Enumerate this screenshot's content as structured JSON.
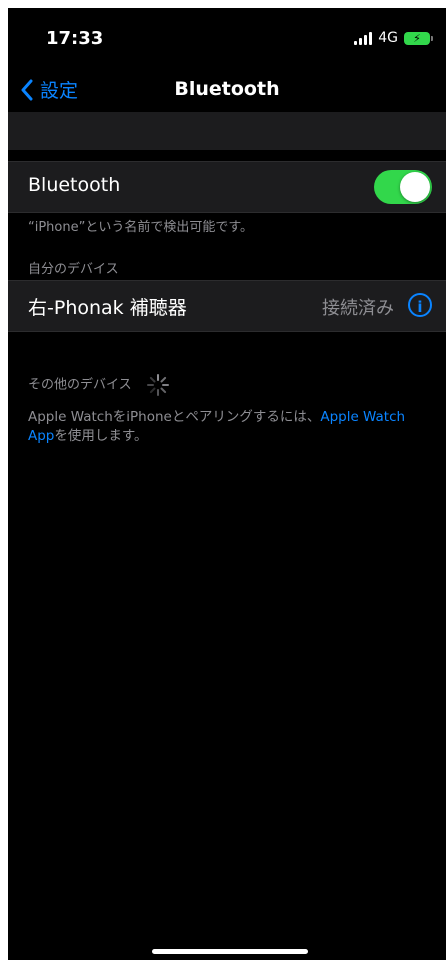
{
  "status_bar": {
    "time": "17:33",
    "network": "4G"
  },
  "nav": {
    "back_label": "設定",
    "title": "Bluetooth"
  },
  "bluetooth": {
    "label": "Bluetooth",
    "enabled": true,
    "discoverable_note": "“iPhone”という名前で検出可能です。"
  },
  "my_devices": {
    "header": "自分のデバイス",
    "items": [
      {
        "name": "右-Phonak 補聴器",
        "status": "接続済み"
      }
    ]
  },
  "other_devices": {
    "header": "その他のデバイス"
  },
  "pairing_note": {
    "text_before": "Apple WatchをiPhoneとペアリングするには、",
    "link_text": "Apple Watch App",
    "text_after": "を使用します。"
  },
  "colors": {
    "accent": "#0a84ff",
    "toggle_on": "#32d74b",
    "background": "#000000",
    "cell": "#1c1c1e"
  },
  "icons": [
    "signal-icon",
    "battery-charging-icon",
    "chevron-left-icon",
    "info-icon",
    "spinner-icon"
  ]
}
